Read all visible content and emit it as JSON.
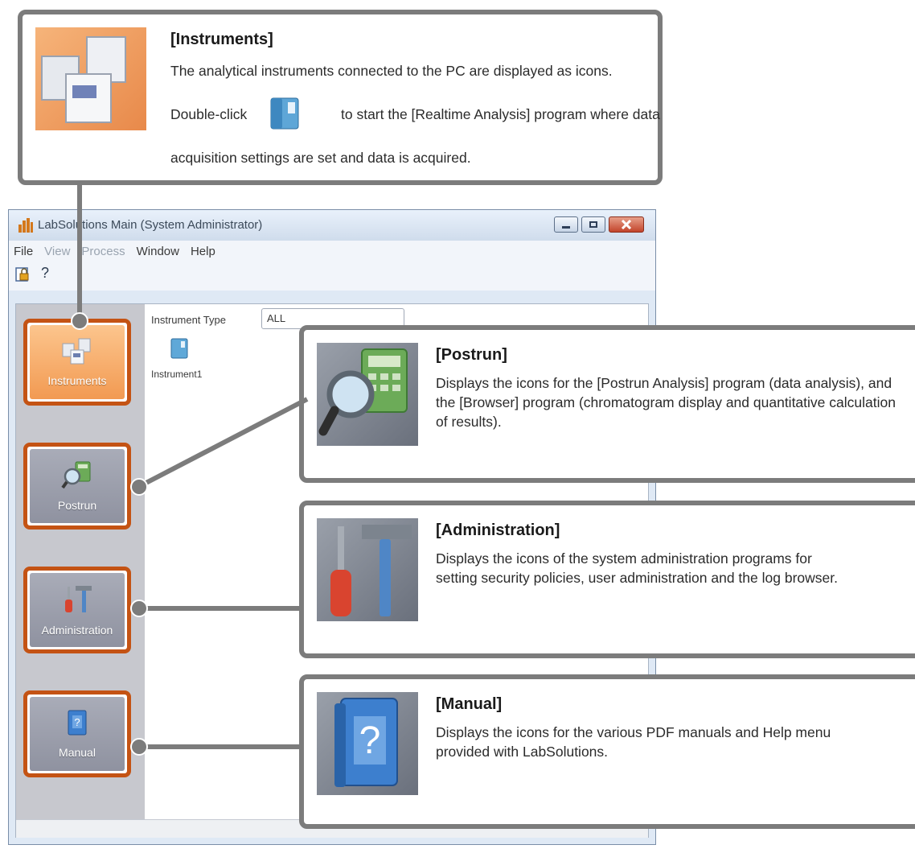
{
  "window": {
    "title": "LabSolutions Main (System Administrator)",
    "menu": [
      "File",
      "View",
      "Process",
      "Window",
      "Help"
    ],
    "toolbar_help": "?"
  },
  "sidebar": {
    "items": [
      {
        "label": "Instruments",
        "icon": "instruments-icon",
        "active": true
      },
      {
        "label": "Postrun",
        "icon": "postrun-icon",
        "active": false
      },
      {
        "label": "Administration",
        "icon": "administration-icon",
        "active": false
      },
      {
        "label": "Manual",
        "icon": "manual-icon",
        "active": false
      }
    ]
  },
  "main": {
    "instrument_type_label": "Instrument Type",
    "instrument_type_value": "ALL",
    "instruments": [
      {
        "label": "Instrument1",
        "icon": "instrument-icon"
      }
    ]
  },
  "callouts": {
    "instruments": {
      "title": "[Instruments]",
      "line1": "The analytical instruments connected to the PC are displayed as icons.",
      "line2_pre": "Double-click",
      "line2_post": "to start the [Realtime Analysis] program where data",
      "line3": "acquisition settings are set and data is acquired."
    },
    "postrun": {
      "title": "[Postrun]",
      "body": "Displays the icons for the [Postrun Analysis] program (data analysis), and the [Browser] program (chromatogram display and quantitative calculation of results)."
    },
    "administration": {
      "title": "[Administration]",
      "body": "Displays the icons of the system administration programs for setting security policies, user administration and the log browser."
    },
    "manual": {
      "title": "[Manual]",
      "body": "Displays the icons for the various PDF manuals and Help menu provided with LabSolutions."
    }
  },
  "colors": {
    "highlight_border": "#c45314",
    "callout_border": "#7c7c7c",
    "active_nav": "#f29a52"
  }
}
